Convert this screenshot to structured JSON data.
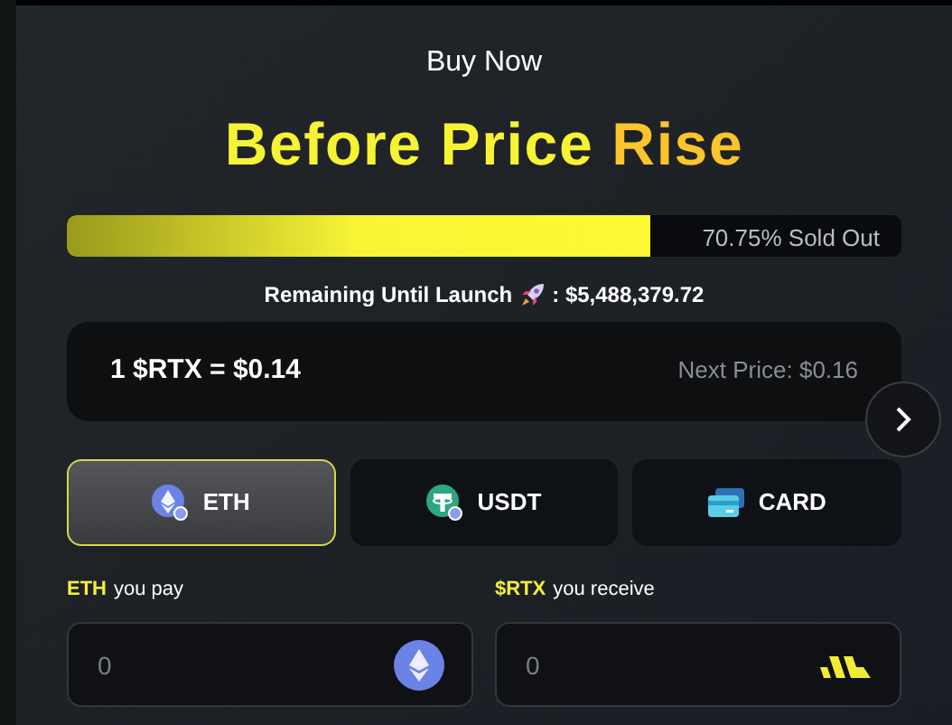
{
  "eyebrow": "Buy Now",
  "headline": {
    "main": "Before Price",
    "accent": "Rise"
  },
  "progress": {
    "level": 0.7,
    "label": "70.75% Sold Out"
  },
  "remaining": {
    "label": "Remaining Until Launch",
    "amount": ": $5,488,379.72"
  },
  "price": {
    "current": "1 $RTX = $0.14",
    "next": "Next Price: $0.16"
  },
  "methods": [
    {
      "kind": "eth",
      "label": "ETH",
      "selected": true
    },
    {
      "kind": "usdt",
      "label": "USDT",
      "selected": false
    },
    {
      "kind": "card",
      "label": "CARD",
      "selected": false
    }
  ],
  "fields": [
    {
      "kind": "eth",
      "currency": "ETH",
      "label": "you pay",
      "placeholder": "0"
    },
    {
      "kind": "rtx",
      "currency": "$RTX",
      "label": "you receive",
      "placeholder": "0"
    }
  ]
}
